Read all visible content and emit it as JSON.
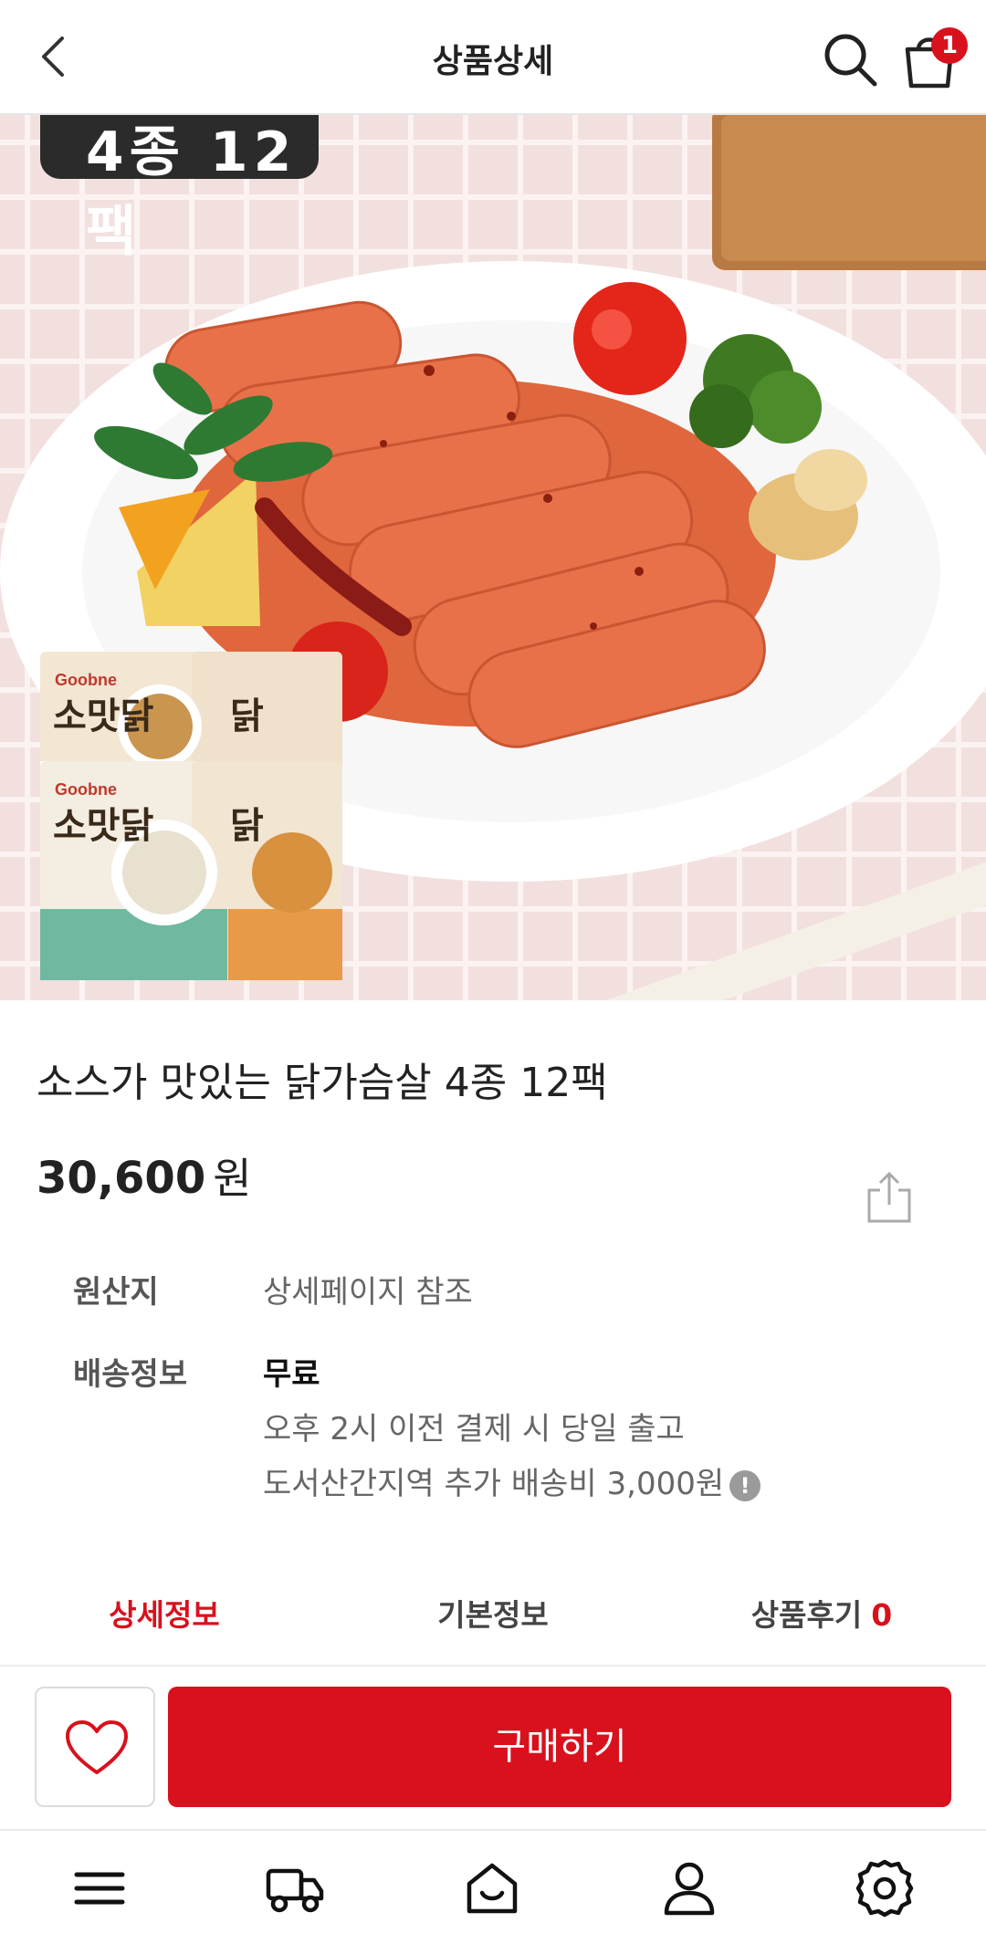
{
  "header": {
    "title": "상품상세",
    "cart_count": "1",
    "icons": [
      "back-icon",
      "search-icon",
      "cart-icon"
    ]
  },
  "product": {
    "image_tag": "4종 12팩",
    "name": "소스가 맛있는 닭가슴살 4종 12팩",
    "price": "30,600",
    "price_unit": "원"
  },
  "info": {
    "origin_label": "원산지",
    "origin_value": "상세페이지 참조",
    "shipping_label": "배송정보",
    "shipping_fee": "무료",
    "shipping_note_1": "오후 2시 이전 결제 시 당일 출고",
    "shipping_note_2": "도서산간지역 추가 배송비 3,000원",
    "info_icon_glyph": "!"
  },
  "tabs": [
    {
      "label": "상세정보",
      "active": true
    },
    {
      "label": "기본정보",
      "active": false
    },
    {
      "label": "상품후기",
      "count": "0",
      "active": false
    }
  ],
  "purchase": {
    "buy_label": "구매하기"
  },
  "package": {
    "brand": "Goobne",
    "product": "소맛닭"
  },
  "bottom_nav": [
    "menu-icon",
    "delivery-truck-icon",
    "home-icon",
    "user-icon",
    "settings-icon"
  ],
  "colors": {
    "accent": "#d8111d",
    "text": "#222222",
    "muted": "#666666"
  }
}
